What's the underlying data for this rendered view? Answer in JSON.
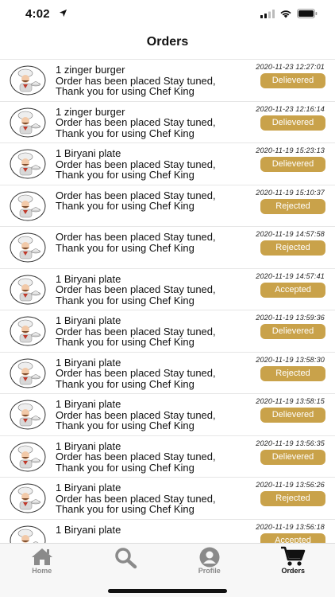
{
  "status_bar": {
    "time": "4:02"
  },
  "nav": {
    "title": "Orders"
  },
  "colors": {
    "badge": "#c9a24a",
    "tab_inactive": "#8a8a8a",
    "tab_active": "#111111"
  },
  "orders": [
    {
      "line1": "1 zinger burger",
      "line2": "Order has been placed Stay tuned,",
      "line3": "Thank you for using Chef King",
      "time": "2020-11-23 12:27:01",
      "status": "Delievered"
    },
    {
      "line1": "1 zinger burger",
      "line2": "Order has been placed Stay tuned,",
      "line3": "Thank you for using Chef King",
      "time": "2020-11-23 12:16:14",
      "status": "Delievered"
    },
    {
      "line1": "1 Biryani plate",
      "line2": "Order has been placed Stay tuned,",
      "line3": "Thank you for using Chef King",
      "time": "2020-11-19 15:23:13",
      "status": "Delievered"
    },
    {
      "line1": "",
      "line2": "Order has been placed Stay tuned,",
      "line3": "Thank you for using Chef King",
      "time": "2020-11-19 15:10:37",
      "status": "Rejected"
    },
    {
      "line1": "",
      "line2": "Order has been placed Stay tuned,",
      "line3": "Thank you for using Chef King",
      "time": "2020-11-19 14:57:58",
      "status": "Rejected"
    },
    {
      "line1": "1 Biryani plate",
      "line2": "Order has been placed Stay tuned,",
      "line3": "Thank you for using Chef King",
      "time": "2020-11-19 14:57:41",
      "status": "Accepted"
    },
    {
      "line1": "1 Biryani plate",
      "line2": "Order has been placed Stay tuned,",
      "line3": "Thank you for using Chef King",
      "time": "2020-11-19 13:59:36",
      "status": "Delievered"
    },
    {
      "line1": "1 Biryani plate",
      "line2": "Order has been placed Stay tuned,",
      "line3": "Thank you for using Chef King",
      "time": "2020-11-19 13:58:30",
      "status": "Rejected"
    },
    {
      "line1": "1 Biryani plate",
      "line2": "Order has been placed Stay tuned,",
      "line3": "Thank you for using Chef King",
      "time": "2020-11-19 13:58:15",
      "status": "Delievered"
    },
    {
      "line1": "1 Biryani plate",
      "line2": "Order has been placed Stay tuned,",
      "line3": "Thank you for using Chef King",
      "time": "2020-11-19 13:56:35",
      "status": "Delievered"
    },
    {
      "line1": "1 Biryani plate",
      "line2": "Order has been placed Stay tuned,",
      "line3": "Thank you for using Chef King",
      "time": "2020-11-19 13:56:26",
      "status": "Rejected"
    },
    {
      "line1": "1 Biryani plate",
      "line2": "",
      "line3": "",
      "time": "2020-11-19 13:56:18",
      "status": "Accepted"
    }
  ],
  "tabs": [
    {
      "label": "Home",
      "icon": "home-icon",
      "active": false
    },
    {
      "label": "",
      "icon": "search-icon",
      "active": false
    },
    {
      "label": "Profile",
      "icon": "profile-icon",
      "active": false
    },
    {
      "label": "Orders",
      "icon": "cart-icon",
      "active": true
    }
  ]
}
